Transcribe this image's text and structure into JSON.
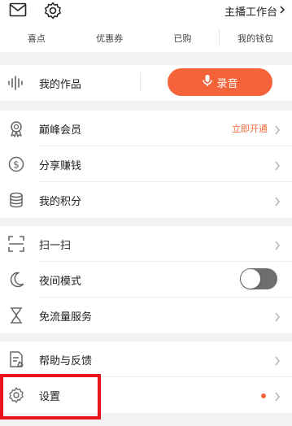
{
  "header": {
    "studio_label": "主播工作台",
    "icons": {
      "mail": "mail-icon",
      "settings": "gear-icon",
      "chevron": "chevron-right-icon"
    }
  },
  "quickbar": {
    "items": [
      {
        "label": "喜点"
      },
      {
        "label": "优惠券"
      },
      {
        "label": "已购"
      },
      {
        "label": "我的钱包"
      }
    ]
  },
  "works": {
    "label": "我的作品",
    "record_label": "录音",
    "accent": "#f4633a"
  },
  "group1": {
    "items": [
      {
        "label": "巅峰会员",
        "hint": "立即开通",
        "icon": "award-icon"
      },
      {
        "label": "分享赚钱",
        "icon": "dollar-icon"
      },
      {
        "label": "我的积分",
        "icon": "coins-icon"
      }
    ]
  },
  "group2": {
    "items": [
      {
        "label": "扫一扫",
        "icon": "scan-icon"
      },
      {
        "label": "夜间模式",
        "icon": "moon-icon",
        "toggle": false
      },
      {
        "label": "免流量服务",
        "icon": "hourglass-icon"
      }
    ]
  },
  "group3": {
    "items": [
      {
        "label": "帮助与反馈",
        "icon": "feedback-icon"
      },
      {
        "label": "设置",
        "icon": "settings-icon",
        "has_dot": true
      }
    ]
  },
  "colors": {
    "hint": "#f26b3a",
    "highlight": "#e8141c",
    "toggle_off": "#6e6e6e"
  }
}
